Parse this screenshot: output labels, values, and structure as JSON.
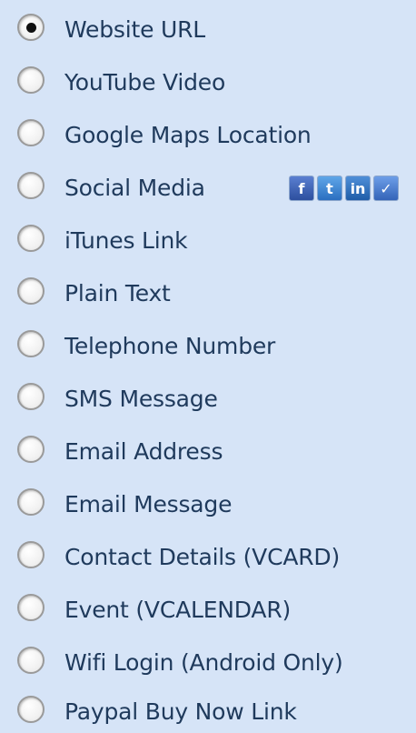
{
  "options": [
    {
      "label": "Website URL",
      "checked": true
    },
    {
      "label": "YouTube Video",
      "checked": false
    },
    {
      "label": "Google Maps Location",
      "checked": false
    },
    {
      "label": "Social Media",
      "checked": false,
      "icons": [
        "facebook-icon",
        "twitter-icon",
        "linkedin-icon",
        "checkmark-icon"
      ]
    },
    {
      "label": "iTunes Link",
      "checked": false
    },
    {
      "label": "Plain Text",
      "checked": false
    },
    {
      "label": "Telephone Number",
      "checked": false
    },
    {
      "label": "SMS Message",
      "checked": false
    },
    {
      "label": "Email Address",
      "checked": false
    },
    {
      "label": "Email Message",
      "checked": false
    },
    {
      "label": "Contact Details (VCARD)",
      "checked": false
    },
    {
      "label": "Event (VCALENDAR)",
      "checked": false
    },
    {
      "label": "Wifi Login (Android Only)",
      "checked": false
    },
    {
      "label": "Paypal Buy Now Link",
      "checked": false
    }
  ],
  "colors": {
    "background": "#d6e4f7",
    "label_text": "#1f3a5c"
  }
}
